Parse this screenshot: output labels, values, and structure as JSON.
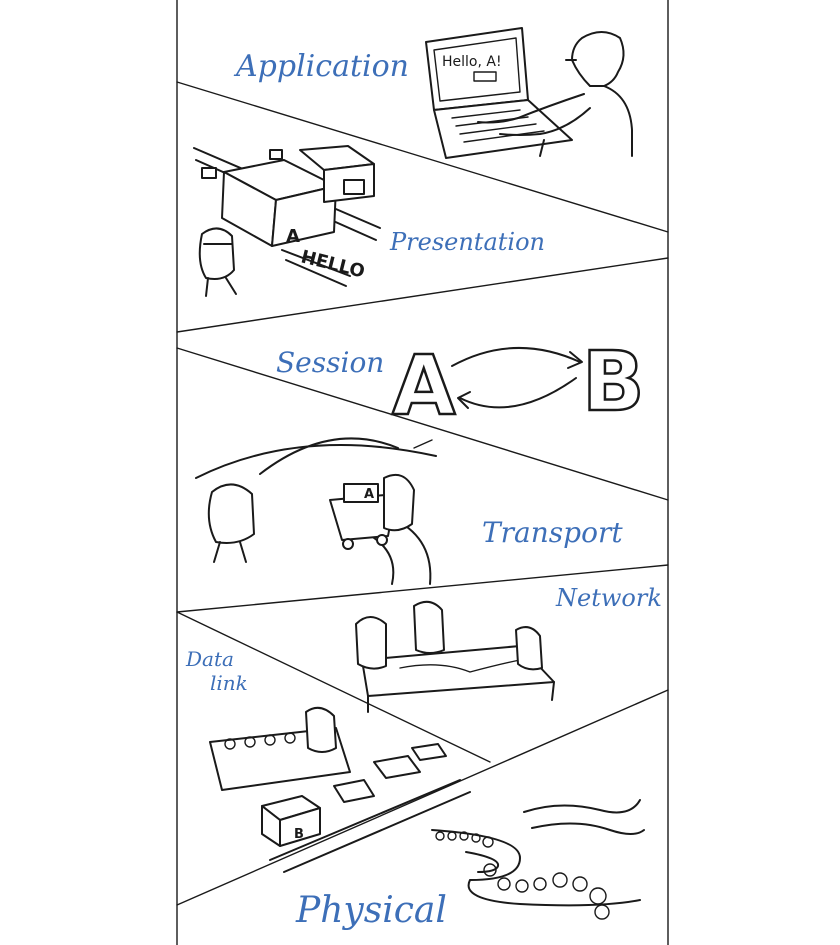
{
  "layers": [
    {
      "id": "application",
      "label": "Application"
    },
    {
      "id": "presentation",
      "label": "Presentation"
    },
    {
      "id": "session",
      "label": "Session"
    },
    {
      "id": "transport",
      "label": "Transport"
    },
    {
      "id": "network",
      "label": "Network"
    },
    {
      "id": "datalink",
      "label_line1": "Data",
      "label_line2": "link"
    },
    {
      "id": "physical",
      "label": "Physical"
    }
  ],
  "application_screen_text": "Hello, A!",
  "presentation_sign_text": "HELLO",
  "presentation_box_letter": "A",
  "session_nodes": {
    "from": "A",
    "to": "B"
  },
  "transport_parcel_letter": "A",
  "datalink_box_letter": "B",
  "colors": {
    "label": "#3d6fb8",
    "ink": "#1a1a1a",
    "background": "#ffffff"
  }
}
